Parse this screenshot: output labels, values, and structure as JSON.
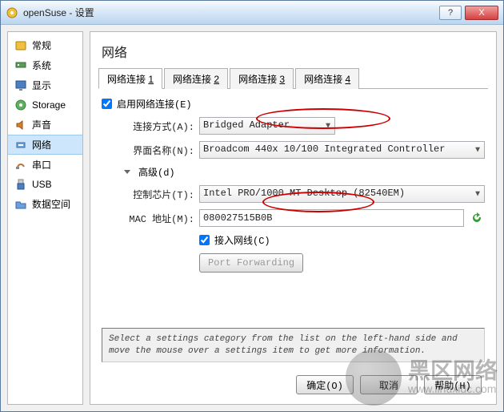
{
  "window": {
    "title": "openSuse - 设置",
    "buttons": {
      "help": "?",
      "close": "X"
    }
  },
  "sidebar": {
    "items": [
      {
        "label": "常规",
        "icon": "general"
      },
      {
        "label": "系统",
        "icon": "system"
      },
      {
        "label": "显示",
        "icon": "display"
      },
      {
        "label": "Storage",
        "icon": "storage"
      },
      {
        "label": "声音",
        "icon": "audio"
      },
      {
        "label": "网络",
        "icon": "network"
      },
      {
        "label": "串口",
        "icon": "serial"
      },
      {
        "label": "USB",
        "icon": "usb"
      },
      {
        "label": "数据空间",
        "icon": "shared"
      }
    ]
  },
  "main": {
    "heading": "网络",
    "tabs": [
      {
        "prefix": "网络连接 ",
        "num": "1"
      },
      {
        "prefix": "网络连接 ",
        "num": "2"
      },
      {
        "prefix": "网络连接 ",
        "num": "3"
      },
      {
        "prefix": "网络连接 ",
        "num": "4"
      }
    ],
    "enable": {
      "label": "启用网络连接(E)",
      "checked": true
    },
    "connType": {
      "label": "连接方式(A):",
      "value": "Bridged Adapter"
    },
    "ifaceName": {
      "label": "界面名称(N):",
      "value": "Broadcom 440x 10/100 Integrated Controller"
    },
    "advanced": {
      "label": "高级(d)"
    },
    "chipset": {
      "label": "控制芯片(T):",
      "value": "Intel PRO/1000 MT Desktop (82540EM)"
    },
    "mac": {
      "label": "MAC 地址(M):",
      "value": "080027515B0B"
    },
    "cable": {
      "label": "接入网线(C)",
      "checked": true
    },
    "portfwd": {
      "label": "Port Forwarding"
    },
    "hint": "Select a settings category from the list on the left-hand side and move the mouse over a settings item to get more information."
  },
  "footer": {
    "ok": "确定(O)",
    "cancel": "取消",
    "help": "帮助(H)"
  },
  "watermark": {
    "line1": "黑区网络",
    "line2": "www.linuxidc.com"
  }
}
